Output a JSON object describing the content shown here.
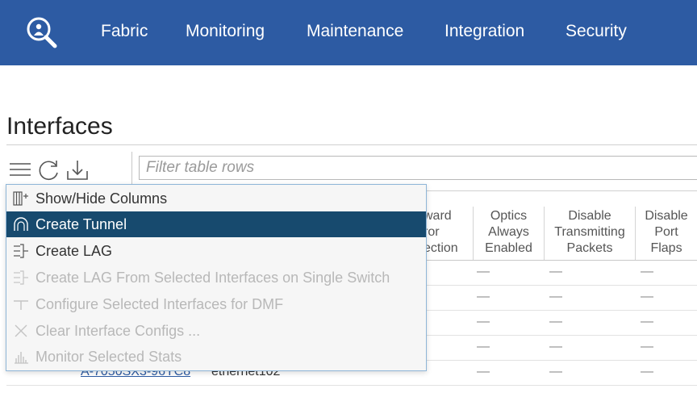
{
  "nav": {
    "items": [
      {
        "label": "Fabric"
      },
      {
        "label": "Monitoring"
      },
      {
        "label": "Maintenance"
      },
      {
        "label": "Integration"
      },
      {
        "label": "Security"
      }
    ]
  },
  "page": {
    "title": "Interfaces"
  },
  "filter": {
    "placeholder": "Filter table rows",
    "value": ""
  },
  "table": {
    "columns": [
      {
        "lines": [
          "ward",
          "ror",
          "ection"
        ]
      },
      {
        "lines": [
          "Optics",
          "Always",
          "Enabled"
        ]
      },
      {
        "lines": [
          "Disable",
          "Transmitting",
          "Packets"
        ]
      },
      {
        "lines": [
          "Disable",
          "Port",
          "Flaps"
        ]
      }
    ],
    "dash": "—",
    "partial_row": {
      "switch": "A-7050SX3-96YC8",
      "interface": "ethernet102"
    }
  },
  "menu": {
    "items": [
      {
        "label": "Show/Hide Columns",
        "icon": "columns-icon",
        "state": "normal"
      },
      {
        "label": "Create Tunnel",
        "icon": "tunnel-icon",
        "state": "active"
      },
      {
        "label": "Create LAG",
        "icon": "lag-icon",
        "state": "normal"
      },
      {
        "label": "Create LAG From Selected Interfaces on Single Switch",
        "icon": "lag-icon",
        "state": "disabled"
      },
      {
        "label": "Configure Selected Interfaces for DMF",
        "icon": "dmf-icon",
        "state": "disabled"
      },
      {
        "label": "Clear Interface Configs ...",
        "icon": "close-icon",
        "state": "disabled"
      },
      {
        "label": "Monitor Selected Stats",
        "icon": "stats-icon",
        "state": "disabled"
      }
    ]
  },
  "colors": {
    "nav_bg": "#2d5ba3",
    "menu_active_bg": "#174a6e",
    "link": "#2d5ba3"
  }
}
